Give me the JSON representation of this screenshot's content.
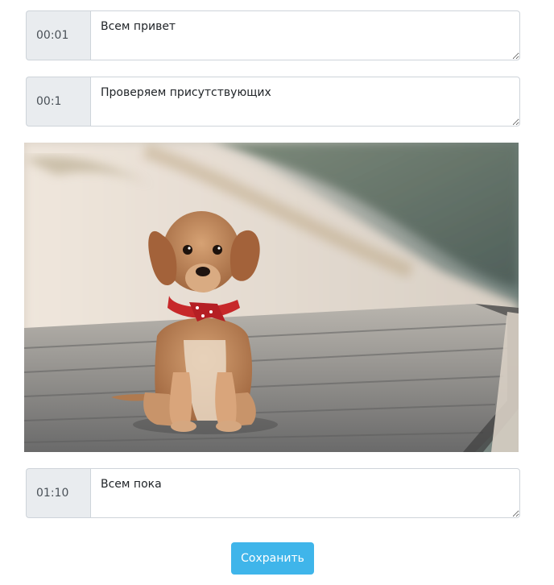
{
  "entries": [
    {
      "time": "00:01",
      "text": "Всем привет"
    },
    {
      "time": "00:1",
      "text": "Проверяем присутствующих"
    },
    {
      "time": "01:10",
      "text": "Всем пока"
    }
  ],
  "image": {
    "description_icon": "puppy-photo"
  },
  "actions": {
    "save_label": "Сохранить"
  },
  "colors": {
    "addon_bg": "#e9ecef",
    "border": "#ced4da",
    "button_bg": "#3fb5ea",
    "button_text": "#ffffff"
  }
}
